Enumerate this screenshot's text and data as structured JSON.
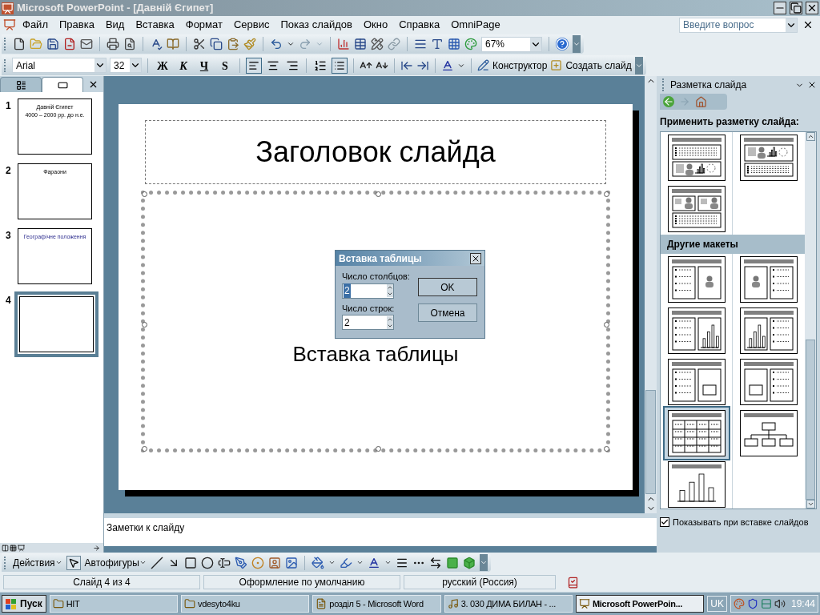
{
  "window": {
    "title": "Microsoft PowerPoint - [Давній Єгипет]"
  },
  "menu": [
    "Файл",
    "Правка",
    "Вид",
    "Вставка",
    "Формат",
    "Сервис",
    "Показ слайдов",
    "Окно",
    "Справка",
    "OmniPage"
  ],
  "help_search": {
    "placeholder": "Введите вопрос"
  },
  "standard_toolbar": {
    "zoom": "67%"
  },
  "formatting_toolbar": {
    "font": "Arial",
    "size": "32",
    "style_buttons": [
      {
        "label": "Ж",
        "selected": false
      },
      {
        "label": "К",
        "selected": false
      },
      {
        "label": "Ч",
        "selected": false
      },
      {
        "label": "S",
        "selected": false
      }
    ],
    "align_buttons": [
      {
        "kind": "left",
        "selected": true
      },
      {
        "kind": "center",
        "selected": false
      },
      {
        "kind": "right",
        "selected": false
      }
    ],
    "list_buttons": [
      {
        "kind": "numbered",
        "selected": false
      },
      {
        "kind": "bulleted",
        "selected": true
      }
    ],
    "design_button": "Конструктор",
    "new_slide_button": "Создать слайд"
  },
  "panel_tabs": [
    {
      "kind": "outline",
      "selected": false
    },
    {
      "kind": "slides",
      "selected": true
    }
  ],
  "slides": [
    {
      "number": "1",
      "lines": [
        "Давній Єгипет",
        "4000 – 2000 рр. до н.е."
      ],
      "selected": false
    },
    {
      "number": "2",
      "lines": [
        "Фараони"
      ],
      "selected": false
    },
    {
      "number": "3",
      "lines": [
        "Географічне положення"
      ],
      "selected": false
    },
    {
      "number": "4",
      "selected": true
    }
  ],
  "slide": {
    "title": "Заголовок слайда",
    "content_placeholder": "Вставка таблицы"
  },
  "dialog": {
    "title": "Вставка таблицы",
    "fields": [
      {
        "label": "Число столбцов:",
        "value": "2",
        "focused": true
      },
      {
        "label": "Число строк:",
        "value": "2",
        "focused": false
      }
    ],
    "buttons": [
      "OK",
      "Отмена"
    ]
  },
  "notes": {
    "placeholder": "Заметки к слайду"
  },
  "task_pane": {
    "title": "Разметка слайда",
    "apply_heading": "Применить разметку слайда:",
    "layouts": [
      {
        "kind": "text-over-content",
        "selected": false
      },
      {
        "kind": "content-over-text",
        "selected": false
      },
      {
        "kind": "two-content-over-text",
        "selected": false
      }
    ],
    "other_heading": "Другие макеты",
    "other_layouts": [
      {
        "kind": "text-clipart",
        "selected": false
      },
      {
        "kind": "clipart-text",
        "selected": false
      },
      {
        "kind": "text-chart",
        "selected": false
      },
      {
        "kind": "chart-text",
        "selected": false
      },
      {
        "kind": "text-media",
        "selected": false
      },
      {
        "kind": "media-text",
        "selected": false
      },
      {
        "kind": "table",
        "selected": true
      },
      {
        "kind": "org-chart",
        "selected": false
      },
      {
        "kind": "chart",
        "selected": false
      }
    ],
    "show_on_insert": {
      "label": "Показывать при вставке слайдов",
      "checked": true
    }
  },
  "drawing_toolbar": {
    "actions": "Действия",
    "autoshapes": "Автофигуры"
  },
  "status_bar": [
    "Слайд 4 из 4",
    "Оформление по умолчанию",
    "русский (Россия)"
  ],
  "taskbar": {
    "start": "Пуск",
    "items": [
      {
        "label": "HIT",
        "kind": "folder",
        "selected": false
      },
      {
        "label": "vdesyto4ku",
        "kind": "folder",
        "selected": false
      },
      {
        "label": "розділ 5 - Microsoft Word",
        "kind": "document",
        "selected": false
      },
      {
        "label": "3. 030 ДИМА БИЛАН - ...",
        "kind": "media",
        "selected": false
      },
      {
        "label": "Microsoft PowerPoin...",
        "kind": "presentation",
        "selected": true
      }
    ],
    "language": "UK",
    "clock": "19:44"
  }
}
